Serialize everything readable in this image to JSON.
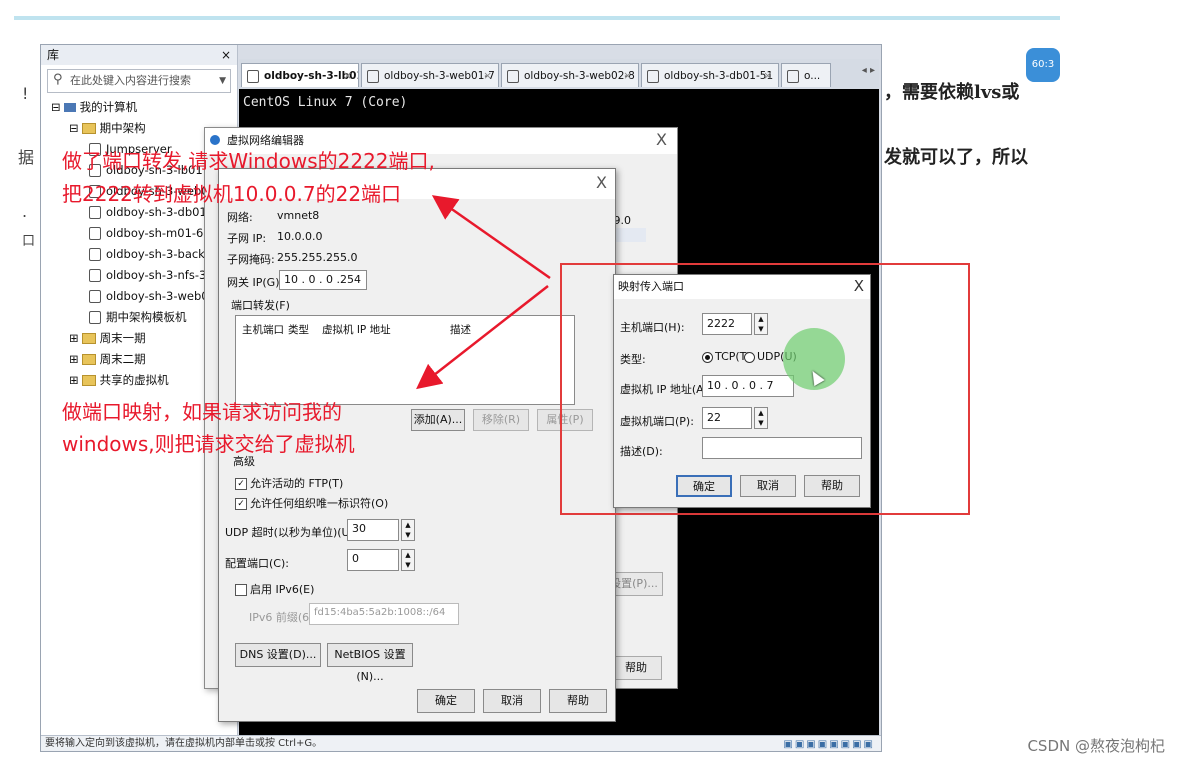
{
  "article": {
    "right_line1": "，需要依赖lvs或",
    "right_line2": "发就可以了，所以",
    "left_marks": [
      "!",
      "据",
      ".",
      "口"
    ],
    "badge_text": "60:3",
    "watermark": "CSDN @熬夜泡枸杞"
  },
  "library": {
    "title": "库",
    "close": "×",
    "search_placeholder": "在此处键入内容进行搜索",
    "tree": [
      {
        "label": "我的计算机",
        "level": 1,
        "kind": "pc",
        "expander": "⊟"
      },
      {
        "label": "期中架构",
        "level": 2,
        "kind": "folder",
        "expander": "⊟"
      },
      {
        "label": "Jumpserver",
        "level": 3,
        "kind": "vm"
      },
      {
        "label": "oldboy-sh-3-lb01",
        "level": 3,
        "kind": "vm"
      },
      {
        "label": "oldboy-sh-3-web02",
        "level": 3,
        "kind": "vm"
      },
      {
        "label": "oldboy-sh-3-db01-",
        "level": 3,
        "kind": "vm"
      },
      {
        "label": "oldboy-sh-m01-61",
        "level": 3,
        "kind": "vm"
      },
      {
        "label": "oldboy-sh-3-backu",
        "level": 3,
        "kind": "vm"
      },
      {
        "label": "oldboy-sh-3-nfs-31",
        "level": 3,
        "kind": "vm"
      },
      {
        "label": "oldboy-sh-3-web01",
        "level": 3,
        "kind": "vm"
      },
      {
        "label": "期中架构模板机",
        "level": 3,
        "kind": "vm"
      },
      {
        "label": "周末一期",
        "level": 2,
        "kind": "folder",
        "expander": "⊞"
      },
      {
        "label": "周末二期",
        "level": 2,
        "kind": "folder",
        "expander": "⊞"
      },
      {
        "label": "共享的虚拟机",
        "level": 2,
        "kind": "folder",
        "expander": "⊞"
      }
    ],
    "statusbar": "要将输入定向到该虚拟机，请在虚拟机内部单击或按 Ctrl+G。"
  },
  "tabs": [
    {
      "label": "oldboy-sh-3-lb01",
      "active": true
    },
    {
      "label": "oldboy-sh-3-web01-7",
      "active": false
    },
    {
      "label": "oldboy-sh-3-web02-8",
      "active": false
    },
    {
      "label": "oldboy-sh-3-db01-51",
      "active": false
    },
    {
      "label": "o...",
      "active": false
    }
  ],
  "tab_close": "×",
  "tab_scroll": "◂ ▸",
  "console": {
    "line1": "CentOS Linux 7 (Core)"
  },
  "vne": {
    "title": "虚拟网络编辑器",
    "close": "X",
    "ip_fragment": "9.0",
    "settings_btn": "设置(P)...",
    "help_btn": "帮助"
  },
  "nat": {
    "close": "X",
    "network_label": "网络:",
    "network_value": "vmnet8",
    "subnet_ip_label": "子网 IP:",
    "subnet_ip_value": "10.0.0.0",
    "subnet_mask_label": "子网掩码:",
    "subnet_mask_value": "255.255.255.0",
    "gateway_label": "网关 IP(G):",
    "gateway_value": "10 . 0 . 0 .254",
    "port_forward_label": "端口转发(F)",
    "columns": [
      "主机端口",
      "类型",
      "虚拟机 IP 地址",
      "描述"
    ],
    "add_btn": "添加(A)...",
    "remove_btn": "移除(R)",
    "props_btn": "属性(P)",
    "advanced_label": "高级",
    "allow_ftp": "允许活动的 FTP(T)",
    "allow_uuid": "允许任何组织唯一标识符(O)",
    "udp_timeout_label": "UDP 超时(以秒为单位)(U):",
    "udp_timeout_value": "30",
    "config_port_label": "配置端口(C):",
    "config_port_value": "0",
    "enable_ipv6": "启用 IPv6(E)",
    "ipv6_prefix_label": "IPv6 前缀(6):",
    "ipv6_prefix_value": "fd15:4ba5:5a2b:1008::/64",
    "dns_btn": "DNS 设置(D)...",
    "netbios_btn": "NetBIOS 设置(N)...",
    "ok_btn": "确定",
    "cancel_btn": "取消",
    "help_btn": "帮助"
  },
  "portmap": {
    "title": "映射传入端口",
    "close": "X",
    "host_port_label": "主机端口(H):",
    "host_port_value": "2222",
    "type_label": "类型:",
    "tcp_label": "TCP(T)",
    "udp_label": "UDP(U)",
    "vm_ip_label": "虚拟机 IP 地址(A):",
    "vm_ip_value": "10 . 0 . 0 . 7",
    "vm_port_label": "虚拟机端口(P):",
    "vm_port_value": "22",
    "desc_label": "描述(D):",
    "desc_value": "",
    "ok_btn": "确定",
    "cancel_btn": "取消",
    "help_btn": "帮助"
  },
  "annotations": {
    "top_line1": "做了端口转发,请求Windows的2222端口,",
    "top_line2": "把2222转到虚拟机10.0.0.7的22端口",
    "bottom_line1": "做端口映射，如果请求访问我的",
    "bottom_line2": "windows,则把请求交给了虚拟机"
  },
  "colors": {
    "annotation": "#e8192c",
    "highlight_box": "#e23b3b",
    "console_bg": "#000000"
  }
}
